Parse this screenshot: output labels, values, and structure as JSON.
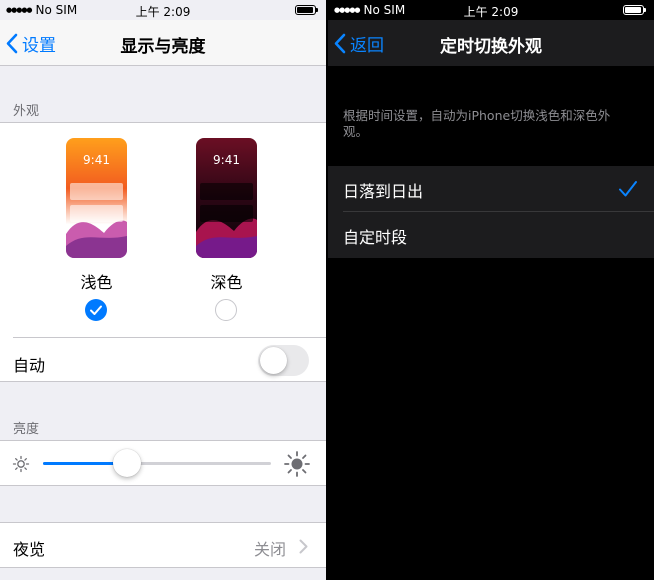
{
  "left": {
    "status": {
      "carrier": "No SIM",
      "time": "上午 2:09"
    },
    "nav": {
      "back_label": "设置",
      "title": "显示与亮度"
    },
    "appearance": {
      "header": "外观",
      "light": {
        "preview_time": "9:41",
        "label": "浅色",
        "selected": true
      },
      "dark": {
        "preview_time": "9:41",
        "label": "深色",
        "selected": false
      },
      "auto_label": "自动",
      "auto_enabled": false
    },
    "brightness": {
      "header": "亮度",
      "level": 0.37
    },
    "night_shift": {
      "label": "夜览",
      "value": "关闭"
    }
  },
  "right": {
    "status": {
      "carrier": "No SIM",
      "time": "上午 2:09"
    },
    "nav": {
      "back_label": "返回",
      "title": "定时切换外观"
    },
    "description": "根据时间设置，自动为iPhone切换浅色和深色外观。",
    "options": [
      {
        "label": "日落到日出",
        "checked": true
      },
      {
        "label": "自定时段",
        "checked": false
      }
    ]
  },
  "colors": {
    "accent": "#007aff",
    "dark_accent": "#0a84ff",
    "light_bg": "#efeff4",
    "dark_bg": "#000000",
    "dark_cell": "#1c1c1e"
  },
  "icons": [
    "chevron-left-icon",
    "check-icon",
    "sun-small-icon",
    "sun-large-icon",
    "chevron-right-icon",
    "signal-icon",
    "battery-icon"
  ]
}
